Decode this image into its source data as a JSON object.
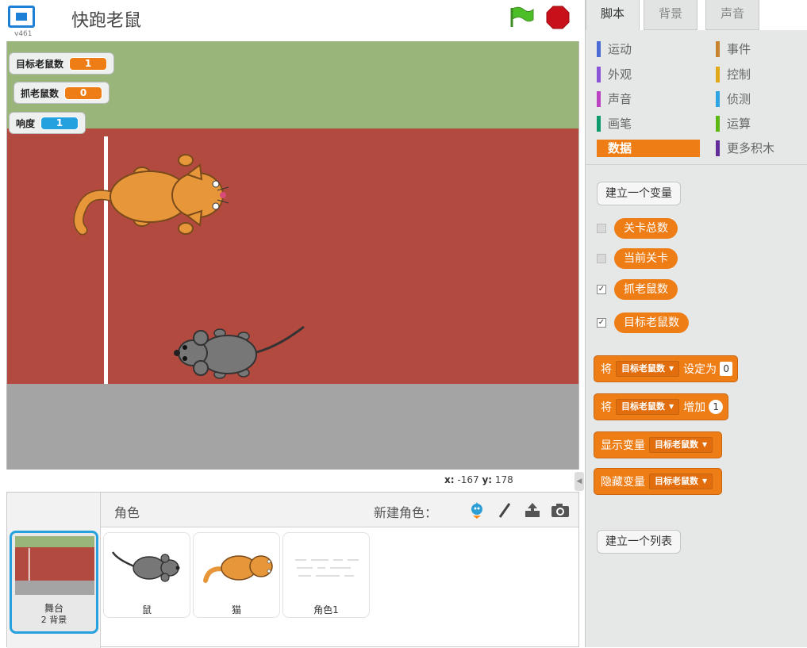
{
  "header": {
    "project_title": "快跑老鼠",
    "version": "v461"
  },
  "stage": {
    "monitors": [
      {
        "label": "目标老鼠数",
        "value": "1",
        "color": "#ee7d16"
      },
      {
        "label": "抓老鼠数",
        "value": "0",
        "color": "#ee7d16"
      },
      {
        "label": "响度",
        "value": "1",
        "color": "#26a1e0"
      }
    ],
    "coords": {
      "x_label": "x:",
      "x": "-167",
      "y_label": "y:",
      "y": "178"
    }
  },
  "sprites_pane": {
    "title": "角色",
    "new_sprite_label": "新建角色：",
    "new_sprite_icons": [
      "sprite-library-icon",
      "paint-brush-icon",
      "upload-icon",
      "camera-icon"
    ],
    "stage_thumb": {
      "name": "舞台",
      "backdrops": "2 背景"
    },
    "sprites": [
      {
        "name": "鼠"
      },
      {
        "name": "猫"
      },
      {
        "name": "角色1"
      }
    ]
  },
  "palette": {
    "tabs": [
      "脚本",
      "背景",
      "声音"
    ],
    "active_tab": "脚本",
    "categories": [
      {
        "label": "运动",
        "color": "#4a6cd4"
      },
      {
        "label": "外观",
        "color": "#8a55d7"
      },
      {
        "label": "声音",
        "color": "#bb42c3"
      },
      {
        "label": "画笔",
        "color": "#0e9a6c"
      },
      {
        "label": "数据",
        "color": "#ee7d16"
      },
      {
        "label": "事件",
        "color": "#c88330"
      },
      {
        "label": "控制",
        "color": "#e1a91a"
      },
      {
        "label": "侦测",
        "color": "#2ca5e2"
      },
      {
        "label": "运算",
        "color": "#5cb712"
      },
      {
        "label": "更多积木",
        "color": "#632d99"
      }
    ],
    "active_category": "数据",
    "make_variable": "建立一个变量",
    "variables": [
      {
        "name": "关卡总数",
        "checked": false
      },
      {
        "name": "当前关卡",
        "checked": false
      },
      {
        "name": "抓老鼠数",
        "checked": true
      },
      {
        "name": "目标老鼠数",
        "checked": true
      }
    ],
    "check_mark": "✓",
    "blocks": {
      "set": {
        "prefix": "将",
        "var": "目标老鼠数",
        "middle": "设定为",
        "value": "0"
      },
      "change": {
        "prefix": "将",
        "var": "目标老鼠数",
        "middle": "增加",
        "value": "1"
      },
      "show": {
        "prefix": "显示变量",
        "var": "目标老鼠数"
      },
      "hide": {
        "prefix": "隐藏变量",
        "var": "目标老鼠数"
      }
    },
    "make_list": "建立一个列表"
  }
}
